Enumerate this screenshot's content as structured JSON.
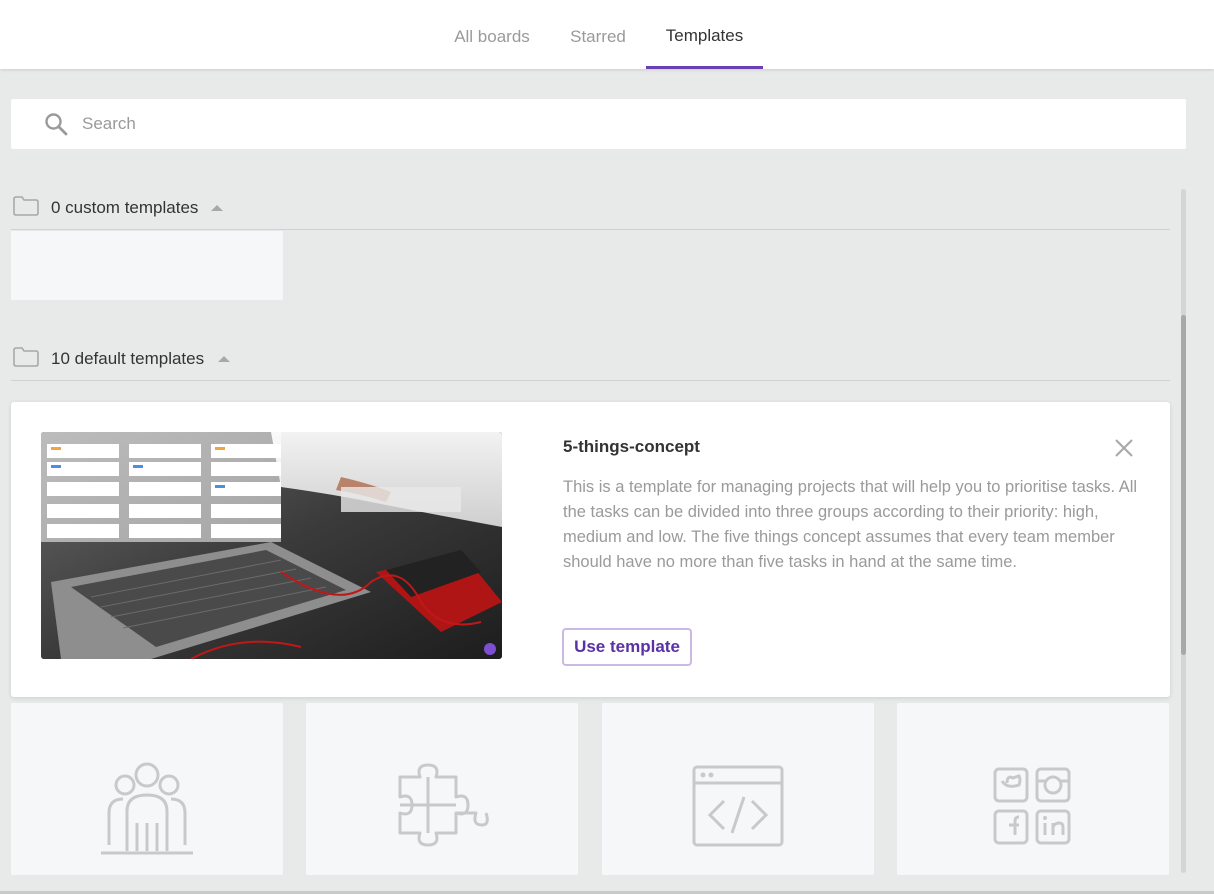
{
  "tabs": [
    {
      "label": "All boards"
    },
    {
      "label": "Starred"
    },
    {
      "label": "Templates"
    }
  ],
  "active_tab": "Templates",
  "accent_color": "#6b3fb5",
  "search": {
    "placeholder": "Search",
    "value": ""
  },
  "sections": {
    "custom": {
      "title": "0 custom templates",
      "icon": "folder-icon",
      "collapse_icon": "caret-up-icon"
    },
    "default": {
      "title": "10 default templates",
      "icon": "folder-icon",
      "collapse_icon": "caret-up-icon"
    }
  },
  "detail": {
    "name": "5-things-concept",
    "description": "This is a template for managing projects that will help you to prioritise tasks. All the tasks can be divided into three groups according to their priority: high, medium and low. The five things concept assumes that every team member should have no more than five tasks in hand at the same time.",
    "use_button": "Use template",
    "close_icon": "close-icon"
  },
  "template_cards": [
    {
      "icon": "team-icon"
    },
    {
      "icon": "puzzle-icon"
    },
    {
      "icon": "code-window-icon"
    },
    {
      "icon": "social-media-icon"
    }
  ]
}
